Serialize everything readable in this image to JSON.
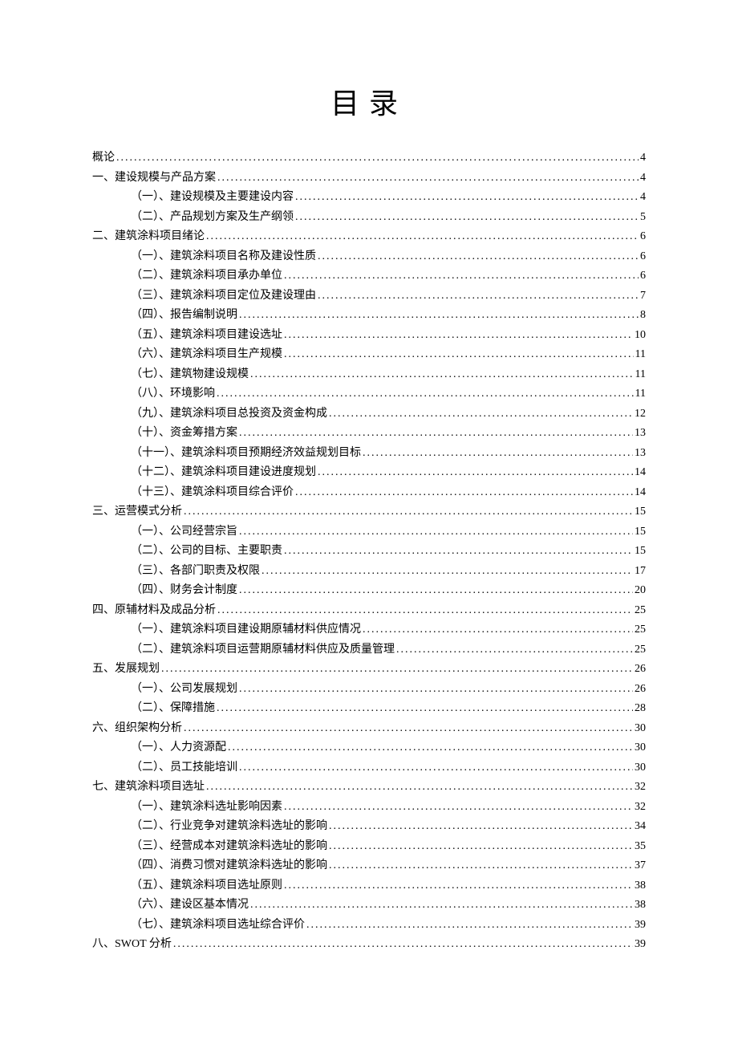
{
  "title": "目录",
  "toc": [
    {
      "level": 0,
      "label": "概论",
      "page": "4"
    },
    {
      "level": 0,
      "label": "一、建设规模与产品方案",
      "page": "4"
    },
    {
      "level": 1,
      "label": "（一）、建设规模及主要建设内容",
      "page": "4"
    },
    {
      "level": 1,
      "label": "（二）、产品规划方案及生产纲领",
      "page": "5"
    },
    {
      "level": 0,
      "label": "二、建筑涂料项目绪论",
      "page": "6"
    },
    {
      "level": 1,
      "label": "（一）、建筑涂料项目名称及建设性质",
      "page": "6"
    },
    {
      "level": 1,
      "label": "（二）、建筑涂料项目承办单位",
      "page": "6"
    },
    {
      "level": 1,
      "label": "（三）、建筑涂料项目定位及建设理由",
      "page": "7"
    },
    {
      "level": 1,
      "label": "（四）、报告编制说明",
      "page": "8"
    },
    {
      "level": 1,
      "label": "（五）、建筑涂料项目建设选址",
      "page": "10"
    },
    {
      "level": 1,
      "label": "（六）、建筑涂料项目生产规模",
      "page": "11"
    },
    {
      "level": 1,
      "label": "（七）、建筑物建设规模",
      "page": "11"
    },
    {
      "level": 1,
      "label": "（八）、环境影响",
      "page": "11"
    },
    {
      "level": 1,
      "label": "（九）、建筑涂料项目总投资及资金构成",
      "page": "12"
    },
    {
      "level": 1,
      "label": "（十）、资金筹措方案",
      "page": "13"
    },
    {
      "level": 1,
      "label": "（十一）、建筑涂料项目预期经济效益规划目标",
      "page": "13"
    },
    {
      "level": 1,
      "label": "（十二）、建筑涂料项目建设进度规划",
      "page": "14"
    },
    {
      "level": 1,
      "label": "（十三）、建筑涂料项目综合评价",
      "page": "14"
    },
    {
      "level": 0,
      "label": "三、运营模式分析",
      "page": "15"
    },
    {
      "level": 1,
      "label": "（一）、公司经营宗旨",
      "page": "15"
    },
    {
      "level": 1,
      "label": "（二）、公司的目标、主要职责",
      "page": "15"
    },
    {
      "level": 1,
      "label": "（三）、各部门职责及权限",
      "page": "17"
    },
    {
      "level": 1,
      "label": "（四）、财务会计制度",
      "page": "20"
    },
    {
      "level": 0,
      "label": "四、原辅材料及成品分析",
      "page": "25"
    },
    {
      "level": 1,
      "label": "（一）、建筑涂料项目建设期原辅材料供应情况",
      "page": "25"
    },
    {
      "level": 1,
      "label": "（二）、建筑涂料项目运营期原辅材料供应及质量管理",
      "page": "25"
    },
    {
      "level": 0,
      "label": "五、发展规划",
      "page": "26"
    },
    {
      "level": 1,
      "label": "（一）、公司发展规划",
      "page": "26"
    },
    {
      "level": 1,
      "label": "（二）、保障措施",
      "page": "28"
    },
    {
      "level": 0,
      "label": "六、组织架构分析",
      "page": "30"
    },
    {
      "level": 1,
      "label": "（一）、人力资源配",
      "page": "30"
    },
    {
      "level": 1,
      "label": "（二）、员工技能培训",
      "page": "30"
    },
    {
      "level": 0,
      "label": "七、建筑涂料项目选址",
      "page": "32"
    },
    {
      "level": 1,
      "label": "（一）、建筑涂料选址影响因素",
      "page": "32"
    },
    {
      "level": 1,
      "label": "（二）、行业竞争对建筑涂料选址的影响",
      "page": "34"
    },
    {
      "level": 1,
      "label": "（三）、经营成本对建筑涂料选址的影响",
      "page": "35"
    },
    {
      "level": 1,
      "label": "（四）、消费习惯对建筑涂料选址的影响",
      "page": "37"
    },
    {
      "level": 1,
      "label": "（五）、建筑涂料项目选址原则",
      "page": "38"
    },
    {
      "level": 1,
      "label": "（六）、建设区基本情况",
      "page": "38"
    },
    {
      "level": 1,
      "label": "（七）、建筑涂料项目选址综合评价",
      "page": "39"
    },
    {
      "level": 0,
      "label": "八、SWOT 分析",
      "page": "39"
    }
  ]
}
